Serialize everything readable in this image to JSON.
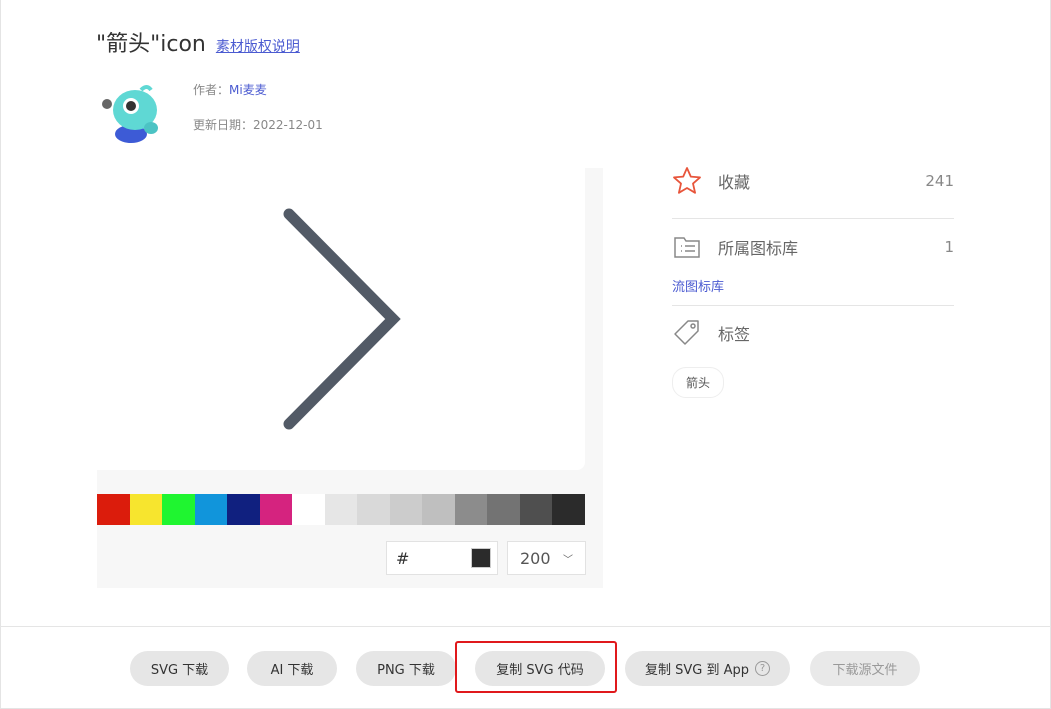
{
  "header": {
    "title": "\"箭头\"icon",
    "license_link": "素材版权说明"
  },
  "author": {
    "label": "作者：",
    "name": "Mi麦麦",
    "date_label": "更新日期：",
    "date": "2022-12-01"
  },
  "preview": {
    "icon": "chevron-right-icon",
    "icon_color": "#525a66",
    "palette": [
      "#db1c0c",
      "#f7e52e",
      "#1ff530",
      "#1195db",
      "#10207f",
      "#d5237f",
      "#ffffff",
      "#e6e6e6",
      "#d9d9d9",
      "#cccccc",
      "#bfbfbf",
      "#8c8c8c",
      "#737373",
      "#4f4f4f",
      "#2b2b2b"
    ],
    "hex_prefix": "#",
    "current_color": "#2b2b2b",
    "size_value": "200"
  },
  "sidebar": {
    "favorite_label": "收藏",
    "favorite_count": "241",
    "library_label": "所属图标库",
    "library_count": "1",
    "library_link": "流图标库",
    "tags_label": "标签",
    "tags": [
      "箭头"
    ]
  },
  "actions": {
    "svg_download": "SVG 下载",
    "ai_download": "AI 下载",
    "png_download": "PNG 下载",
    "copy_svg_code": "复制 SVG 代码",
    "copy_svg_app": "复制 SVG 到 App",
    "help": "?",
    "download_source": "下载源文件"
  }
}
